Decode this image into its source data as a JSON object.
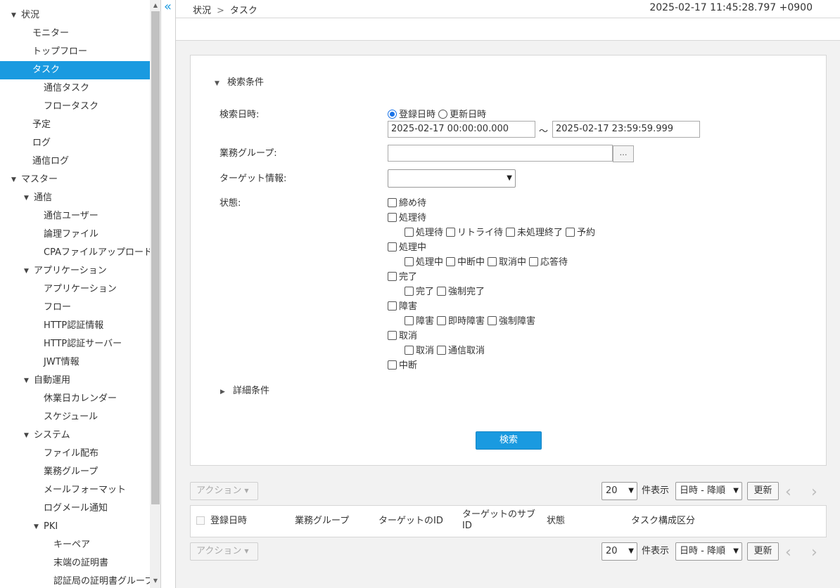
{
  "sidebar": {
    "items": [
      {
        "label": "状況",
        "level": 1,
        "group": true
      },
      {
        "label": "モニター",
        "level": 2
      },
      {
        "label": "トップフロー",
        "level": 2
      },
      {
        "label": "タスク",
        "level": 2,
        "active": true
      },
      {
        "label": "通信タスク",
        "level": 3
      },
      {
        "label": "フロータスク",
        "level": 3
      },
      {
        "label": "予定",
        "level": 2
      },
      {
        "label": "ログ",
        "level": 2
      },
      {
        "label": "通信ログ",
        "level": 2
      },
      {
        "label": "マスター",
        "level": 1,
        "group": true
      },
      {
        "label": "通信",
        "level": 2,
        "group": true
      },
      {
        "label": "通信ユーザー",
        "level": 3
      },
      {
        "label": "論理ファイル",
        "level": 3
      },
      {
        "label": "CPAファイルアップロード",
        "level": 3
      },
      {
        "label": "アプリケーション",
        "level": 2,
        "group": true
      },
      {
        "label": "アプリケーション",
        "level": 3
      },
      {
        "label": "フロー",
        "level": 3
      },
      {
        "label": "HTTP認証情報",
        "level": 3
      },
      {
        "label": "HTTP認証サーバー",
        "level": 3
      },
      {
        "label": "JWT情報",
        "level": 3
      },
      {
        "label": "自動運用",
        "level": 2,
        "group": true
      },
      {
        "label": "休業日カレンダー",
        "level": 3
      },
      {
        "label": "スケジュール",
        "level": 3
      },
      {
        "label": "システム",
        "level": 2,
        "group": true
      },
      {
        "label": "ファイル配布",
        "level": 3
      },
      {
        "label": "業務グループ",
        "level": 3
      },
      {
        "label": "メールフォーマット",
        "level": 3
      },
      {
        "label": "ログメール通知",
        "level": 3
      },
      {
        "label": "PKI",
        "level": 3,
        "group": true
      },
      {
        "label": "キーペア",
        "level": 4
      },
      {
        "label": "末端の証明書",
        "level": 4
      },
      {
        "label": "認証局の証明書グループ",
        "level": 4
      }
    ]
  },
  "header": {
    "collapse_icon": "«",
    "breadcrumb": [
      "状況",
      "タスク"
    ],
    "breadcrumb_sep": ">",
    "timestamp": "2025-02-17 11:45:28.797 +0900"
  },
  "search": {
    "section_label": "検索条件",
    "date_label": "検索日時:",
    "date_mode_options": [
      "登録日時",
      "更新日時"
    ],
    "date_mode_selected": "登録日時",
    "date_from": "2025-02-17 00:00:00.000",
    "date_sep": "～",
    "date_to": "2025-02-17 23:59:59.999",
    "group_label": "業務グループ:",
    "group_value": "",
    "browse_label": "…",
    "target_label": "ターゲット情報:",
    "target_value": "",
    "status_label": "状態:",
    "status_groups": [
      {
        "label": "締め待",
        "children": []
      },
      {
        "label": "処理待",
        "children": [
          "処理待",
          "リトライ待",
          "未処理終了",
          "予約"
        ]
      },
      {
        "label": "処理中",
        "children": [
          "処理中",
          "中断中",
          "取消中",
          "応答待"
        ]
      },
      {
        "label": "完了",
        "children": [
          "完了",
          "強制完了"
        ]
      },
      {
        "label": "障害",
        "children": [
          "障害",
          "即時障害",
          "強制障害"
        ]
      },
      {
        "label": "取消",
        "children": [
          "取消",
          "通信取消"
        ]
      },
      {
        "label": "中断",
        "children": []
      }
    ],
    "detail_label": "詳細条件",
    "search_button": "検索"
  },
  "toolbar": {
    "action_label": "アクション",
    "page_size": "20",
    "page_size_suffix": "件表示",
    "sort": "日時 - 降順",
    "refresh_label": "更新",
    "prev_icon": "‹",
    "next_icon": "›"
  },
  "table": {
    "columns": [
      "登録日時",
      "業務グループ",
      "ターゲットのID",
      "ターゲットのサブ ID",
      "状態",
      "タスク構成区分"
    ]
  }
}
